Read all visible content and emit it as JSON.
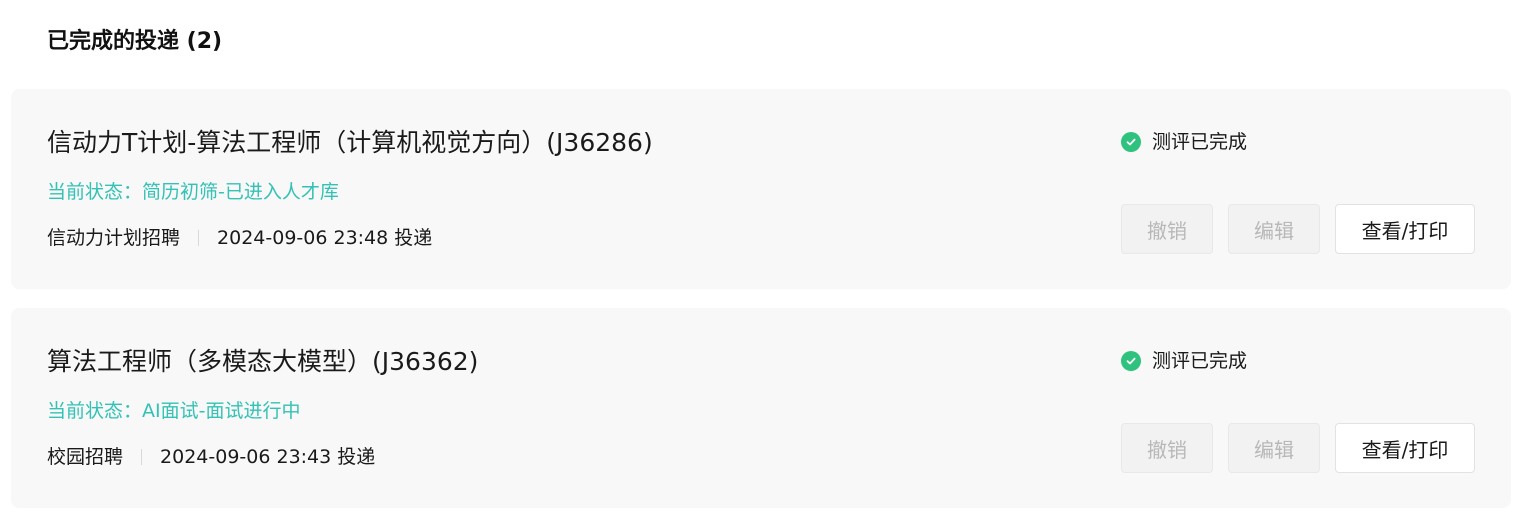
{
  "section": {
    "title": "已完成的投递 (2)"
  },
  "applications": [
    {
      "title": "信动力T计划-算法工程师（计算机视觉方向）(J36286)",
      "status": "当前状态：简历初筛-已进入人才库",
      "channel": "信动力计划招聘",
      "submitted": "2024-09-06 23:48 投递",
      "evaluation": "测评已完成",
      "revoke_label": "撤销",
      "edit_label": "编辑",
      "view_label": "查看/打印"
    },
    {
      "title": "算法工程师（多模态大模型）(J36362)",
      "status": "当前状态：AI面试-面试进行中",
      "channel": "校园招聘",
      "submitted": "2024-09-06 23:43 投递",
      "evaluation": "测评已完成",
      "revoke_label": "撤销",
      "edit_label": "编辑",
      "view_label": "查看/打印"
    }
  ],
  "colors": {
    "status_text": "#33c2b5",
    "check_green": "#2ec27e",
    "card_bg": "#f8f8f8",
    "disabled_text": "#b8b8b8"
  },
  "icons": {
    "evaluation_done": "check-circle-icon"
  }
}
